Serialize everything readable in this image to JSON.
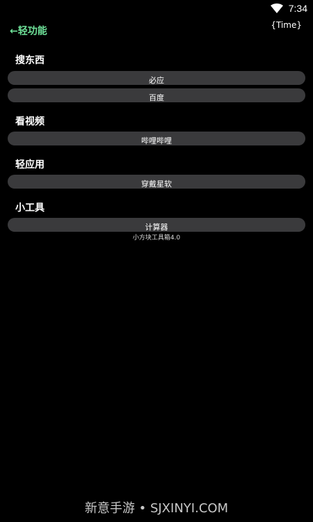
{
  "status_bar": {
    "time": "7:34",
    "wifi_icon": "wifi-icon"
  },
  "header": {
    "back_label": "←轻功能",
    "time_tag": "{Time}",
    "accent_color": "#6fe39a"
  },
  "sections": [
    {
      "title": "搜东西",
      "buttons": [
        "必应",
        "百度"
      ]
    },
    {
      "title": "看视频",
      "buttons": [
        "哔哩哔哩"
      ]
    },
    {
      "title": "轻应用",
      "buttons": [
        "穿戴星软"
      ]
    },
    {
      "title": "小工具",
      "buttons": [
        "计算器"
      ]
    }
  ],
  "footer_text": "小方块工具箱4.0",
  "watermark": "新意手游 • SJXINYI.COM"
}
